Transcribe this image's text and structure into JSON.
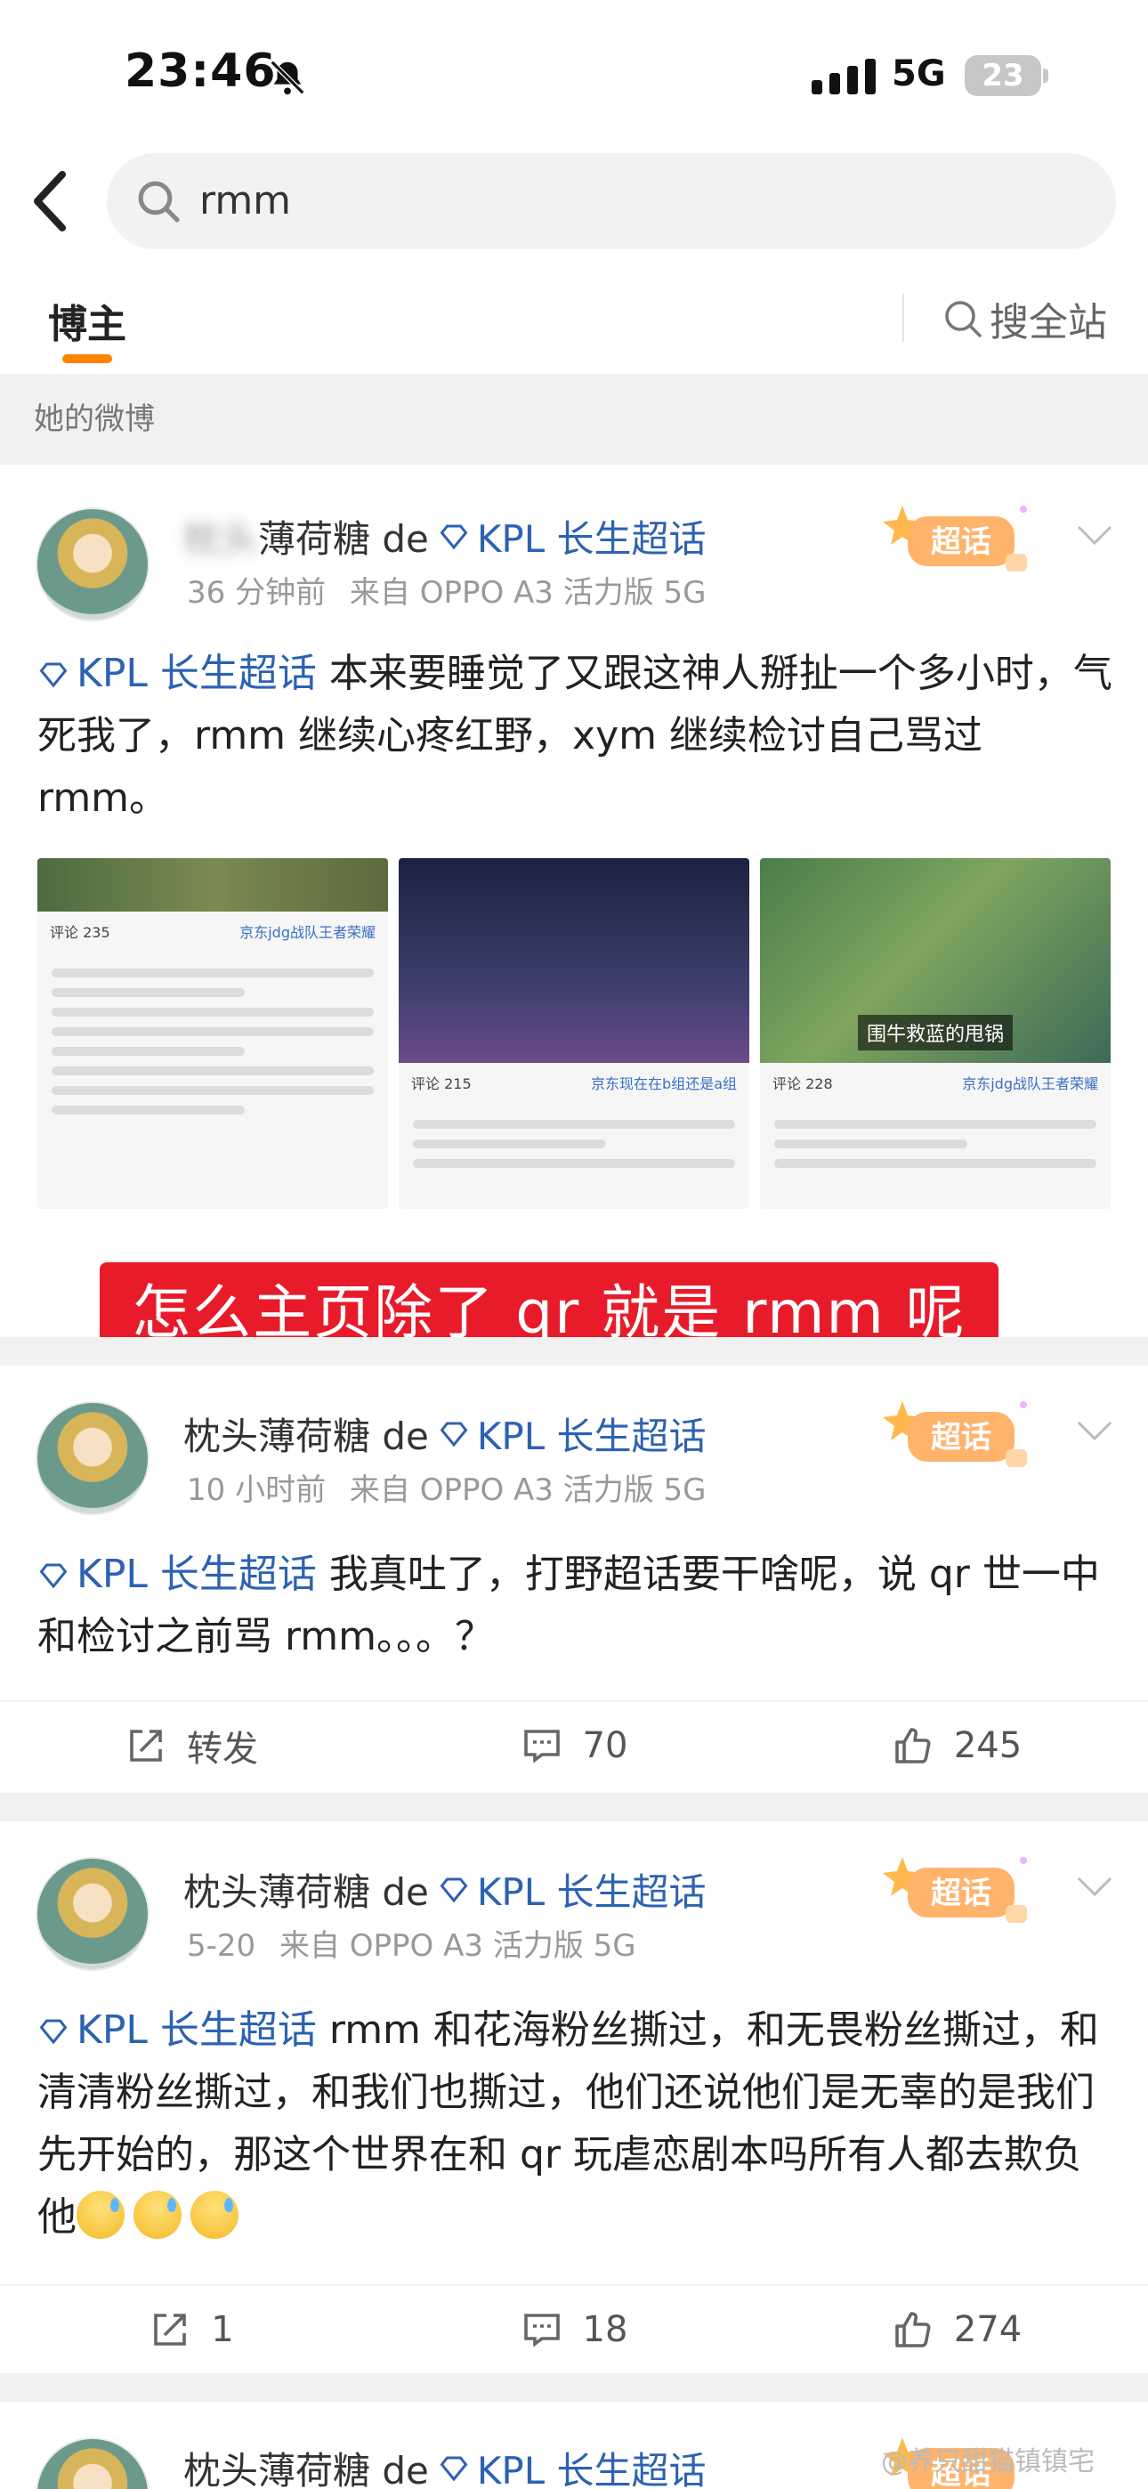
{
  "status_bar": {
    "time": "23:46",
    "network": "5G",
    "battery": "23"
  },
  "search": {
    "query": "rmm"
  },
  "tabs": {
    "bloggers": "博主",
    "search_all": "搜全站"
  },
  "section_label": "她的微博",
  "posts": [
    {
      "username_visible": "枕头薄荷糖 de",
      "username_blur": "枕头",
      "topic_tag": "KPL 长生超话",
      "meta_time": "36 分钟前",
      "meta_source": "来自 OPPO A3 活力版 5G",
      "badge": "超话",
      "topic_inline": "KPL 长生超话",
      "text": " 本来要睡觉了又跟这神人掰扯一个多小时，气死我了，rmm 继续心疼红野，xym 继续检讨自己骂过 rmm。",
      "thumbs": [
        {
          "comments_label": "评论 235",
          "right_label": "京东jdg战队王者荣耀"
        },
        {
          "comments_label": "评论 215",
          "right_label": "京东现在在b组还是a组"
        },
        {
          "comments_label": "评论 228",
          "right_label": "京东jdg战队王者荣耀"
        }
      ],
      "thumb_caption": "围牛救蓝的甩锅"
    },
    {
      "username_visible": "枕头薄荷糖 de",
      "topic_tag": "KPL 长生超话",
      "meta_time": "10 小时前",
      "meta_source": "来自 OPPO A3 活力版 5G",
      "badge": "超话",
      "topic_inline": "KPL 长生超话",
      "text": " 我真吐了，打野超话要干啥呢，说 qr 世一中和检讨之前骂 rmm。。。？",
      "repost": "转发",
      "comments": "70",
      "likes": "245"
    },
    {
      "username_visible": "枕头薄荷糖 de",
      "topic_tag": "KPL 长生超话",
      "meta_time": "5-20",
      "meta_source": "来自 OPPO A3 活力版 5G",
      "badge": "超话",
      "topic_inline": "KPL 长生超话",
      "text": " rmm 和花海粉丝撕过，和无畏粉丝撕过，和清清粉丝撕过，和我们也撕过，他们还说他们是无辜的是我们先开始的，那这个世界在和 qr 玩虐恋剧本吗所有人都去欺负他",
      "repost": "1",
      "comments": "18",
      "likes": "274"
    },
    {
      "username_visible": "枕头薄荷糖 de",
      "topic_tag": "KPL 长生超话",
      "badge": "超话"
    }
  ],
  "overlay_caption": "怎么主页除了 qr 就是 rmm 呢",
  "watermark": "@养只甜猫镇镇宅",
  "colors": {
    "accent": "#ff8200",
    "topic": "#2c62b2",
    "banner": "#e81b2a"
  },
  "icons": [
    "back-arrow-icon",
    "search-icon",
    "bell-off-icon",
    "signal-icon",
    "repost-icon",
    "comment-icon",
    "like-icon",
    "chevron-down-icon",
    "diamond-icon"
  ]
}
